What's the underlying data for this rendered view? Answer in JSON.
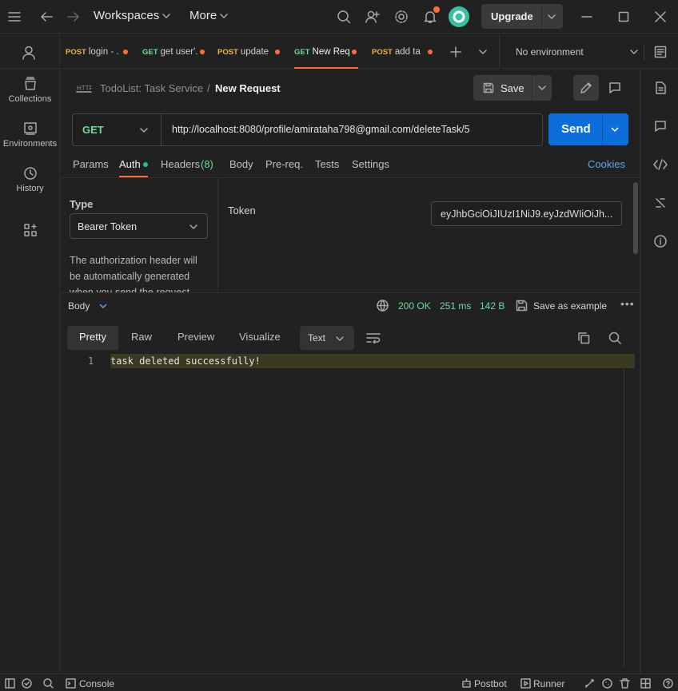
{
  "topbar": {
    "workspaces_label": "Workspaces",
    "more_label": "More",
    "upgrade_label": "Upgrade"
  },
  "sidebar": {
    "items": [
      {
        "label": "Collections",
        "icon": "collections-icon"
      },
      {
        "label": "Environments",
        "icon": "environments-icon"
      },
      {
        "label": "History",
        "icon": "history-icon"
      },
      {
        "label": "",
        "icon": "apps-grid-icon"
      }
    ]
  },
  "tabs": [
    {
      "method": "POST",
      "label": "login - ."
    },
    {
      "method": "GET",
      "label": "get user'."
    },
    {
      "method": "POST",
      "label": "update"
    },
    {
      "method": "GET",
      "label": "New Req"
    },
    {
      "method": "POST",
      "label": "add ta"
    }
  ],
  "environment": {
    "label": "No environment"
  },
  "breadcrumb": {
    "collection": "TodoList: Task Service",
    "separator": "/",
    "request": "New Request"
  },
  "save_label": "Save",
  "request": {
    "method": "GET",
    "url": "http://localhost:8080/profile/amirataha798@gmail.com/deleteTask/5",
    "send_label": "Send"
  },
  "request_tabs": {
    "params": "Params",
    "auth": "Auth",
    "headers": "Headers",
    "headers_count": "(8)",
    "body": "Body",
    "prereq": "Pre-req.",
    "tests": "Tests",
    "settings": "Settings",
    "cookies": "Cookies"
  },
  "auth": {
    "type_heading": "Type",
    "type_value": "Bearer Token",
    "description_1": "The authorization header will",
    "description_2": "be automatically generated",
    "description_3": "when you send the request",
    "token_label": "Token",
    "token_value": "eyJhbGciOiJIUzI1NiJ9.eyJzdWIiOiJh..."
  },
  "response": {
    "body_label": "Body",
    "status": "200 OK",
    "time": "251 ms",
    "size": "142 B",
    "save_example": "Save as example",
    "tabs": {
      "pretty": "Pretty",
      "raw": "Raw",
      "preview": "Preview",
      "visualize": "Visualize"
    },
    "format": "Text",
    "line_number": "1",
    "line_text": "task deleted successfully!"
  },
  "statusbar": {
    "console": "Console",
    "postbot": "Postbot",
    "runner": "Runner"
  },
  "colors": {
    "accent_orange": "#ff6c37",
    "send_blue": "#0d6edb",
    "get_green": "#6bdd9a",
    "post_yellow": "#e8b34a",
    "cookies_blue": "#5ea6f5"
  }
}
